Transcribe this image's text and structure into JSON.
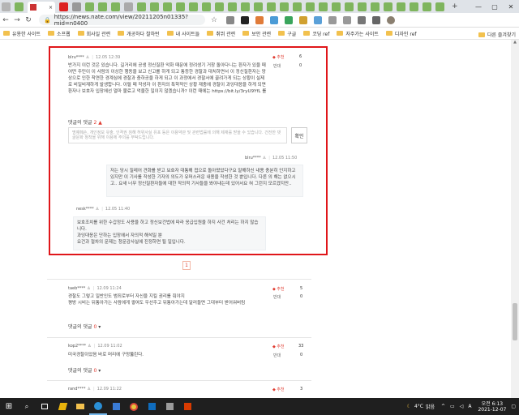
{
  "browser": {
    "url": "https://news.nate.com/view/20211205n01335?mid=n0400",
    "tab_close": "×",
    "tab_add": "+",
    "win_min": "—",
    "win_max": "▢",
    "win_close": "✕",
    "nav_back": "←",
    "nav_forward": "→",
    "nav_reload": "↻",
    "lock": "🔒",
    "star": "☆"
  },
  "bookmarks": {
    "items": [
      "유용한 사이트",
      "소프웹",
      "회사일 관련",
      "개공하다 찰하턴",
      "내 사이트들",
      "취뷔 관련",
      "보안 관련",
      "구글",
      "코딩 ref",
      "자주가는 사이트",
      "디자인 ref"
    ],
    "other": "다른 즐겨찾기"
  },
  "comment_main": {
    "user": "blru****",
    "user_icon": "person-icon",
    "date": "12.05 12:39",
    "vote_up_label": "◆ 추천",
    "vote_up_count": "6",
    "vote_down_label": "반대",
    "vote_down_count": "0",
    "body": "반가지 이런 것은 있습니다. 길거리에 공생 정신질환 악화 때문에 정려생기 거창 돌아다니는 환자가 있을 때 어떤 주민이 이 사람의 이상한 행동을 보고 신고를 하게 되고 통등한 경찰과 대치하면서 이 정신질환자는 망상으로 인한 착연한 경계심에 경찰과 충하공을 하게 되고 이 과정에서 경찰서에 끌려가게 되는 상황이 실제로 비일비재하게 발생합니다. 이럴 때 작성자 이 환자의 특학적인 상황 재충에 경찰이 과잉대응을 하게 되면 환자나 보호자 입장에선 얼마 불료고 억울한 일이지 않겠습니까? 이런 때에는 https://bit.ly/3ryU9YfL 를",
    "reply_label": "댓글의 댓글",
    "reply_count": "2",
    "reply_caret": "▲",
    "input_placeholder": "명예훼손, 개인정보 유출, 인격권 침해 허위사실 유포 등은 이용약관 및 관련법률에 의해 제재를 받을 수 있습니다. 건전한 댓글문화 정착을 위해 이용에 주의를 부탁드립니다.",
    "confirm": "확인"
  },
  "reply1": {
    "user": "blru****",
    "date": "12.05 11:50",
    "body": "저는 당시 질레어 견화를 받고 보호자 대통해 접으로 돌아왔었다구요 말해하신 내용 충분히 인지하고 있지만 이 기사를 작성한 기자의 의도가 유머스러운 내용을 작성한 것 뿐입니다. 다른 의 해는 없으시고.. 요새 너무 정신질환자들에 대한 작의적 기사들을 봐야내는데 있어서요 혀 그런지 모르겠지만.."
  },
  "reply2": {
    "user": "nesk****",
    "date": "12.05 11:40",
    "line1": "보호조치를 위한 수갑정도 사용을 하고 정신보건법에 따라 응급입원을 하지 사건 처리는 하지 않습니다.",
    "line2": "과잉대응은 단하는 입장에서 자의적 해석일 뿐",
    "line3": "요건과 절차의 문제는 청문감사실에 진정하면 될 일입니다."
  },
  "pager": "1",
  "comment2": {
    "user": "taeb****",
    "date": "12.09 11:24",
    "vote_up_label": "◆ 추천",
    "vote_up_count": "5",
    "vote_down_label": "반대",
    "vote_down_count": "0",
    "line1": "경찰도 그렇고 일반인도 범죄로부터 자신을 지킬 권리를 줘야지",
    "line2": "평방 시비는 뒤통아가는 사람에게 쌓여도 우선주고 뒤통아가는데 달러들면 그대부터 받어워버림",
    "reply_label": "댓글의 댓글",
    "reply_count": "0"
  },
  "comment3": {
    "user": "kop2****",
    "date": "12.09 11:02",
    "vote_up_label": "◆ 추천",
    "vote_up_count": "33",
    "vote_down_label": "반대",
    "vote_down_count": "0",
    "line1": "미국경찰이었음 바로 머리에 구멍뚫린다.",
    "reply_label": "댓글의 댓글",
    "reply_count": "0"
  },
  "comment4": {
    "user": "rand****",
    "date": "12.09 11:22",
    "vote_up_label": "◆ 추천",
    "vote_up_count": "3"
  },
  "taskbar": {
    "start": "⊞",
    "search": "⌕",
    "weather": "☾",
    "temp": "4°C",
    "weather_text": "맑음",
    "ime": "A",
    "time": "오전 6:13",
    "date": "2021-12-07"
  }
}
